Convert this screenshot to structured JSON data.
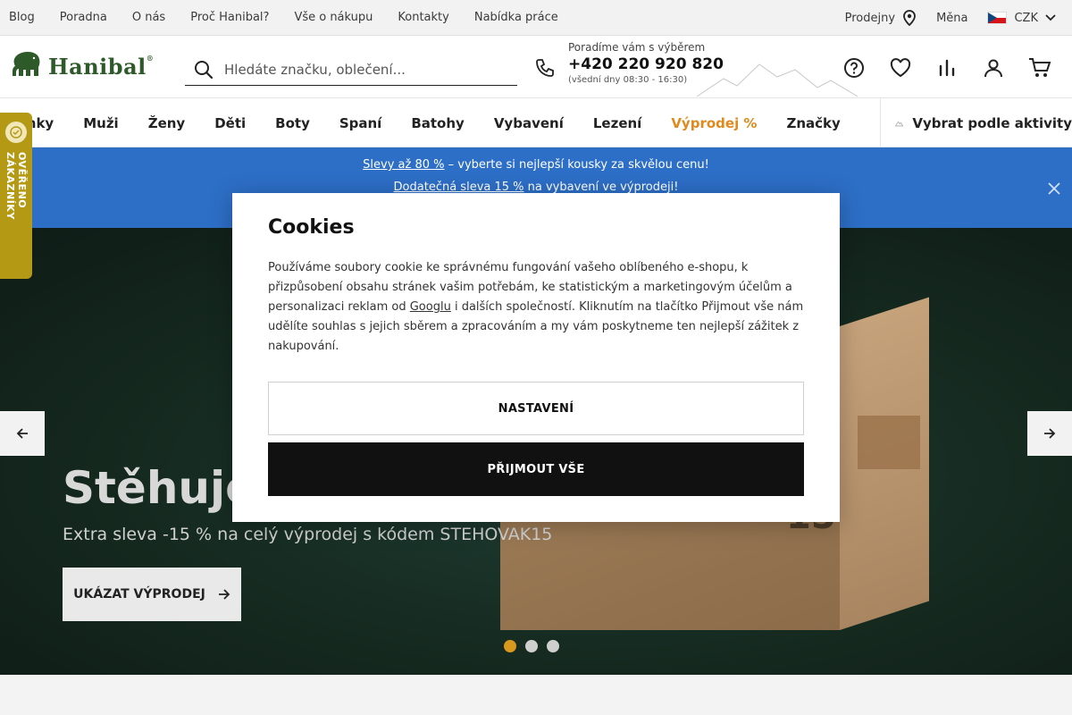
{
  "topbar": {
    "links": [
      "Blog",
      "Poradna",
      "O nás",
      "Proč Hanibal?",
      "Vše o nákupu",
      "Kontakty",
      "Nabídka práce"
    ],
    "stores_label": "Prodejny",
    "currency_label": "Měna",
    "currency_value": "CZK"
  },
  "header": {
    "logo_text": "Hanibal",
    "logo_reg": "®",
    "search_placeholder": "Hledáte značku, oblečení...",
    "phone_hint": "Poradíme vám s výběrem",
    "phone_number": "+420 220 920 820",
    "phone_hours": "(všední dny 08:30 - 16:30)"
  },
  "nav": {
    "categories": [
      "Novinky",
      "Muži",
      "Ženy",
      "Děti",
      "Boty",
      "Spaní",
      "Batohy",
      "Vybavení",
      "Lezení",
      "Výprodej %",
      "Značky"
    ],
    "activity_label": "Vybrat podle aktivity"
  },
  "verified": {
    "label": "OVĚŘENO ZÁKAZNÍKY"
  },
  "promo": {
    "line1_link": "Slevy až 80 %",
    "line1_rest": " – vyberte si nejlepší kousky za skvělou cenu!",
    "line2_link": "Dodatečná sleva 15 %",
    "line2_rest": " na vybavení ve výprodeji!"
  },
  "hero": {
    "title": "Stěhujeme se",
    "subtitle": "Extra sleva -15 % na celý výprodej s kódem STEHOVAK15",
    "button_label": "UKÁZAT VÝPRODEJ",
    "box_number": "15",
    "slides_total": 3,
    "active_slide": 1
  },
  "cookies": {
    "title": "Cookies",
    "text_before_link": "Používáme soubory cookie ke správnému fungování vašeho oblíbeného e-shopu, k přizpůsobení obsahu stránek vašim potřebám, ke statistickým a marketingovým účelům a personalizaci reklam od ",
    "link_text": "Googlu",
    "text_after_link": " i dalších společností. Kliknutím na tlačítko Přijmout vše nám udělíte souhlas s jejich sběrem a zpracováním a my vám poskytneme ten nejlepší zážitek z nakupování.",
    "settings_label": "NASTAVENÍ",
    "accept_label": "PŘIJMOUT VŠE"
  },
  "colors": {
    "promo_blue": "#2d6ec6",
    "sale_orange": "#e08a1e",
    "badge_gold": "#b49a14",
    "dot_active": "#d79a1f",
    "brand_green": "#2e5a2a"
  },
  "icons": [
    "location-pin-icon",
    "chevron-down-icon",
    "search-icon",
    "phone-icon",
    "help-icon",
    "heart-icon",
    "compare-icon",
    "user-icon",
    "cart-icon",
    "mountain-icon",
    "close-icon",
    "arrow-left-icon",
    "arrow-right-icon",
    "elephant-logo-icon"
  ]
}
